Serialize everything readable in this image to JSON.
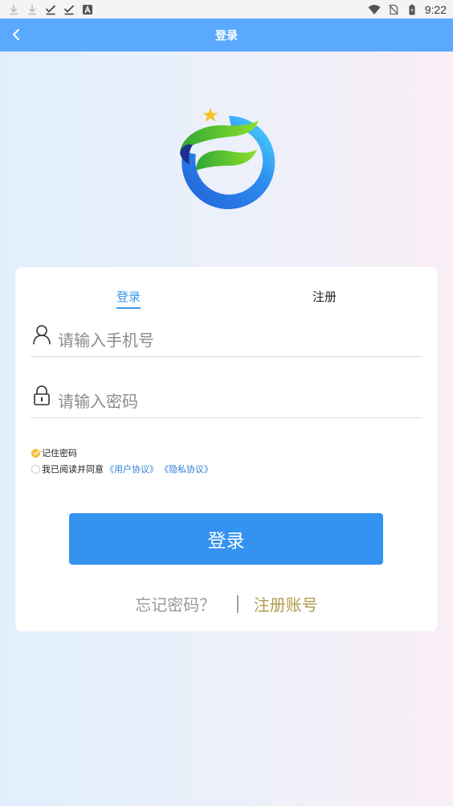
{
  "status_bar": {
    "time": "9:22",
    "icons_left": [
      "download-icon",
      "download-icon",
      "check-icon",
      "check-icon",
      "text-a-icon"
    ],
    "icons_right": [
      "wifi-icon",
      "no-sim-icon",
      "battery-icon"
    ]
  },
  "app_bar": {
    "title": "登录",
    "background": "#5aa9ff"
  },
  "tabs": {
    "login": "登录",
    "register": "注册",
    "active_color": "#3c97ee"
  },
  "form": {
    "phone_placeholder": "请输入手机号",
    "phone_value": "",
    "password_placeholder": "请输入密码",
    "password_value": "",
    "remember_label": "记住密码",
    "remember_checked": true,
    "agree_prefix": "我已阅读并同意",
    "user_agreement": "《用户协议》",
    "privacy_policy": "《隐私协议》",
    "agree_checked": false
  },
  "actions": {
    "login_button": "登录",
    "login_button_color": "#3493f0",
    "forgot_password": "忘记密码？",
    "separator": "|",
    "register_account": "注册账号",
    "register_color": "#b29a4e"
  }
}
